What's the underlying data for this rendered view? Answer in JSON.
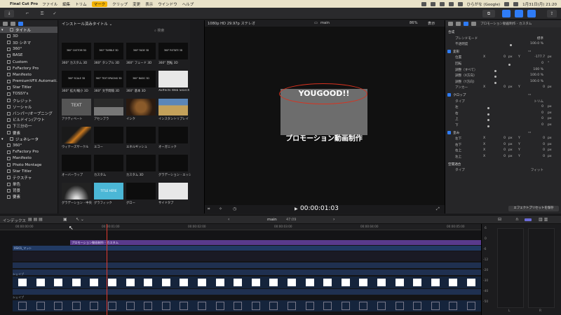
{
  "menubar": {
    "app": "Final Cut Pro",
    "items": [
      "ファイル",
      "編集",
      "トリム",
      "マーク",
      "クリップ",
      "変更",
      "表示",
      "ウインドウ",
      "ヘルプ"
    ],
    "active_index": 3,
    "input_source": "ひらがな (Google)",
    "clock": "1月31日(月) 21:20"
  },
  "browser": {
    "tab_title": "インストール済みタイトル",
    "search_placeholder": "検索",
    "sidebar": [
      {
        "label": "タイトル",
        "level": 0,
        "selected": true
      },
      {
        "label": "3D",
        "level": 1
      },
      {
        "label": "3D シネマ",
        "level": 1
      },
      {
        "label": "360°",
        "level": 1
      },
      {
        "label": "BASE",
        "level": 1
      },
      {
        "label": "Custom",
        "level": 1
      },
      {
        "label": "FxFactory Pro",
        "level": 1
      },
      {
        "label": "Manifesto",
        "level": 1
      },
      {
        "label": "PremiumVFX Automati...",
        "level": 1
      },
      {
        "label": "Star Titler",
        "level": 1
      },
      {
        "label": "TOSSY's",
        "level": 1
      },
      {
        "label": "クレジット",
        "level": 1
      },
      {
        "label": "ソーシャル",
        "level": 1
      },
      {
        "label": "バンパー/オープニング",
        "level": 1
      },
      {
        "label": "ビルドイン/アウト",
        "level": 1
      },
      {
        "label": "下三分の一",
        "level": 1
      },
      {
        "label": "要素",
        "level": 1
      },
      {
        "label": "ジェネレータ",
        "level": 0
      },
      {
        "label": "360°",
        "level": 1
      },
      {
        "label": "FxFactory Pro",
        "level": 1
      },
      {
        "label": "Manifesto",
        "level": 1
      },
      {
        "label": "Photo Montage",
        "level": 1
      },
      {
        "label": "Star Titler",
        "level": 1
      },
      {
        "label": "テクスチャ",
        "level": 1
      },
      {
        "label": "単色",
        "level": 1
      },
      {
        "label": "背景",
        "level": 1
      },
      {
        "label": "要素",
        "level": 1
      }
    ],
    "tiles": [
      {
        "label": "360° カスタム 3D",
        "thumb": "360° CUSTOM 3D",
        "style": "dark"
      },
      {
        "label": "360° タンブル 3D",
        "thumb": "360° TUMBLE 3D",
        "style": "dark"
      },
      {
        "label": "360° フェード 3D",
        "thumb": "360° FADE 3D",
        "style": "dark"
      },
      {
        "label": "360° 回転 3D",
        "thumb": "360° ROTATE 3D",
        "style": "dark"
      },
      {
        "label": "360° 拡大/縮小 3D",
        "thumb": "360° SCALE 3D",
        "style": "dark"
      },
      {
        "label": "360° 文字間隔 3D",
        "thumb": "360° TEXT SPACING 3D",
        "style": "dark"
      },
      {
        "label": "360° 基本 3D",
        "thumb": "360° BASIC 3D",
        "style": "dark"
      },
      {
        "label": "XEffects Web Search Page",
        "thumb": "",
        "style": "white"
      },
      {
        "label": "アクティベート",
        "thumb": "TEXT",
        "style": "textframe"
      },
      {
        "label": "アセンブラ",
        "thumb": "",
        "style": "mountain"
      },
      {
        "label": "インク",
        "thumb": "",
        "style": "ink"
      },
      {
        "label": "インスタントリプレイ",
        "thumb": "",
        "style": "photo"
      },
      {
        "label": "ウィナーズサークル",
        "thumb": "",
        "style": "orange"
      },
      {
        "label": "エコー",
        "thumb": "",
        "style": "dark"
      },
      {
        "label": "エネルギッシュ",
        "thumb": "",
        "style": "dark"
      },
      {
        "label": "オーガニック",
        "thumb": "",
        "style": "dark"
      },
      {
        "label": "オーバーラップ",
        "thumb": "",
        "style": "dark"
      },
      {
        "label": "カスタム",
        "thumb": "",
        "style": "dark"
      },
      {
        "label": "カスタム 3D",
        "thumb": "",
        "style": "dark"
      },
      {
        "label": "グラデーション - エッジ",
        "thumb": "",
        "style": "dark"
      },
      {
        "label": "グラデーション - 中央",
        "thumb": "",
        "style": "glow"
      },
      {
        "label": "グラフィック",
        "thumb": "TITLE HERE",
        "style": "cyan"
      },
      {
        "label": "グロー",
        "thumb": "",
        "style": "dark"
      },
      {
        "label": "サイドタブ",
        "thumb": "",
        "style": "white"
      }
    ]
  },
  "viewer": {
    "format": "1080p HD 29.97p ステレオ",
    "project": "main",
    "zoom": "86%",
    "display_menu": "表示",
    "overlay_title": "YOUGOOD!!",
    "caption": "プロモーション動画制作",
    "timecode": "00:00:01:03"
  },
  "inspector": {
    "clip_name": "プロモーション動画制作 - カスタム",
    "sections": {
      "composite": "合成",
      "blend_mode_label": "ブレンドモード",
      "blend_mode_value": "標準",
      "opacity_label": "不透明度",
      "opacity_value": "100.0 %",
      "transform": "変形",
      "position_label": "位置",
      "position_x": "0",
      "position_y": "-177.7",
      "rotation_label": "回転",
      "rotation_value": "0",
      "scale_all_label": "調整（すべて）",
      "scale_all_value": "100 %",
      "scale_x_label": "調整（X方向）",
      "scale_x_value": "100.0 %",
      "scale_y_label": "調整（Y方向）",
      "scale_y_value": "100.0 %",
      "anchor_label": "アンカー",
      "anchor_x": "0",
      "anchor_y": "0",
      "crop": "クロップ",
      "crop_type_label": "タイプ",
      "crop_type_value": "トリム",
      "crop_left": "左",
      "crop_right": "右",
      "crop_top": "上",
      "crop_bottom": "下",
      "crop_value": "0",
      "distort": "歪み",
      "bl": "左下",
      "br": "右下",
      "tr": "右上",
      "tl": "左上",
      "conform": "空間適合",
      "conform_type_label": "タイプ",
      "conform_type_value": "フィット",
      "unit_px": "px",
      "unit_deg": "°",
      "axis_x": "X",
      "axis_y": "Y",
      "save_preset": "エフェクトプリセットを保存"
    }
  },
  "timeline": {
    "index_label": "インデックス",
    "project": "main",
    "duration": "47:09",
    "ruler": [
      "00:00:00:00",
      "00:00:01:00",
      "00:00:02:00",
      "00:00:03:00",
      "00:00:04:00",
      "00:00:05:00"
    ],
    "title_clip": "プロモーション動画制作 - カスタム",
    "track_label_1": "0Sl01_マット",
    "shape_label": "シェイプ",
    "meter_scale": [
      "6",
      "0",
      "-6",
      "-12",
      "-20",
      "-30",
      "-40",
      "-50"
    ],
    "meter_channels": [
      "L",
      "R"
    ]
  },
  "colors": {
    "accent": "#2f7cf6",
    "title_clip": "#5a3a8c",
    "playhead": "#e03a2f",
    "highlight_ring": "#d8321f"
  }
}
